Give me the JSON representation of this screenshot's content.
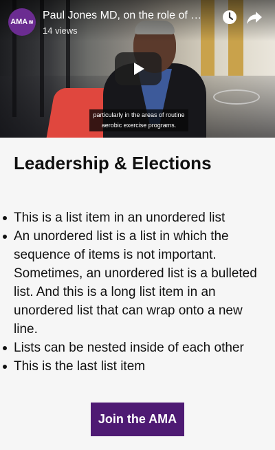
{
  "video": {
    "title": "Paul Jones MD, on the role of …",
    "views": "14 views",
    "caption_line1": "particularly in the areas of routine",
    "caption_line2": "aerobic exercise programs.",
    "logo_text": "AMA",
    "logo_color": "#6b2c91",
    "icons": {
      "logo": "ama-logo",
      "watch_later": "clock-icon",
      "share": "share-arrow-icon",
      "play": "play-icon"
    }
  },
  "section": {
    "heading": "Leadership & Elections"
  },
  "list": {
    "items": [
      "This is a list item in an unordered list",
      "An unordered list is a list in which the sequence of items is not important. Sometimes, an unordered list is a bulleted list. And this is a long list item in an unordered list that can wrap onto a new line.",
      "Lists can be nested inside of each other",
      "This is the last list item"
    ]
  },
  "cta": {
    "label": "Join the AMA",
    "color": "#4e1a73"
  }
}
